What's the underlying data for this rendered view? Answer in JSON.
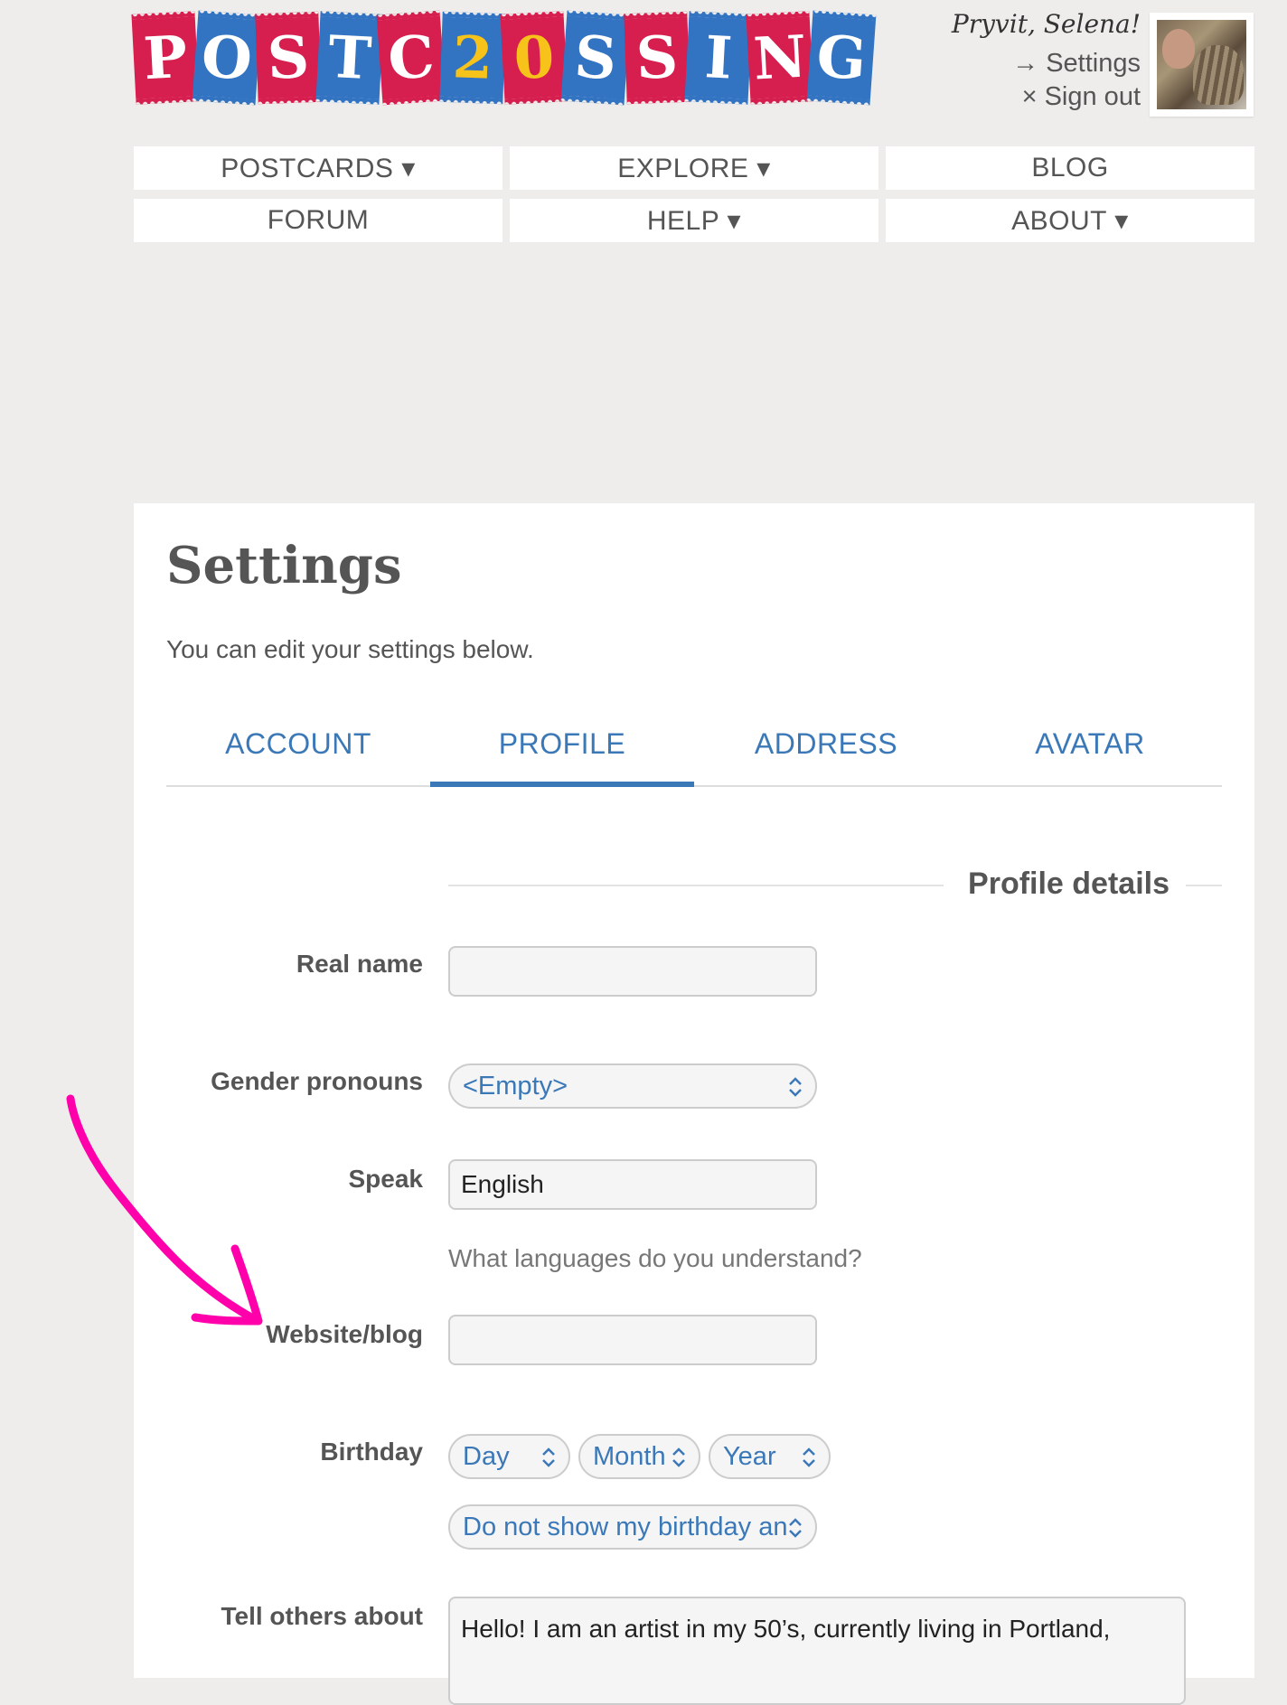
{
  "logo": {
    "letters": [
      "P",
      "O",
      "S",
      "T",
      "C",
      "2",
      "0",
      "S",
      "S",
      "I",
      "N",
      "G"
    ]
  },
  "user": {
    "greeting": "Pryvit, Selena!",
    "settings_link": "→ Settings",
    "signout_link": "× Sign out"
  },
  "nav": {
    "postcards": "POSTCARDS ▾",
    "explore": "EXPLORE ▾",
    "blog": "BLOG",
    "forum": "FORUM",
    "help": "HELP ▾",
    "about": "ABOUT ▾"
  },
  "page": {
    "title": "Settings",
    "intro": "You can edit your settings below."
  },
  "tabs": {
    "account": "ACCOUNT",
    "profile": "PROFILE",
    "address": "ADDRESS",
    "avatar": "AVATAR"
  },
  "form": {
    "legend": "Profile details",
    "real_name_label": "Real name",
    "real_name_value": "",
    "gender_label": "Gender pronouns",
    "gender_value": "<Empty>",
    "speak_label": "Speak",
    "speak_value": "English",
    "speak_help": "What languages do you understand?",
    "website_label": "Website/blog",
    "website_value": "",
    "birthday_label": "Birthday",
    "day": "Day",
    "month": "Month",
    "year": "Year",
    "birthday_privacy": "Do not show my birthday an",
    "about_label": "Tell others about",
    "about_value": "Hello! I am an artist in my 50’s, currently living in Portland,"
  },
  "colors": {
    "accent": "#3b78b8",
    "annotation": "#ff00aa",
    "stamp_pink": "#d61e4f",
    "stamp_blue": "#3273c2"
  }
}
